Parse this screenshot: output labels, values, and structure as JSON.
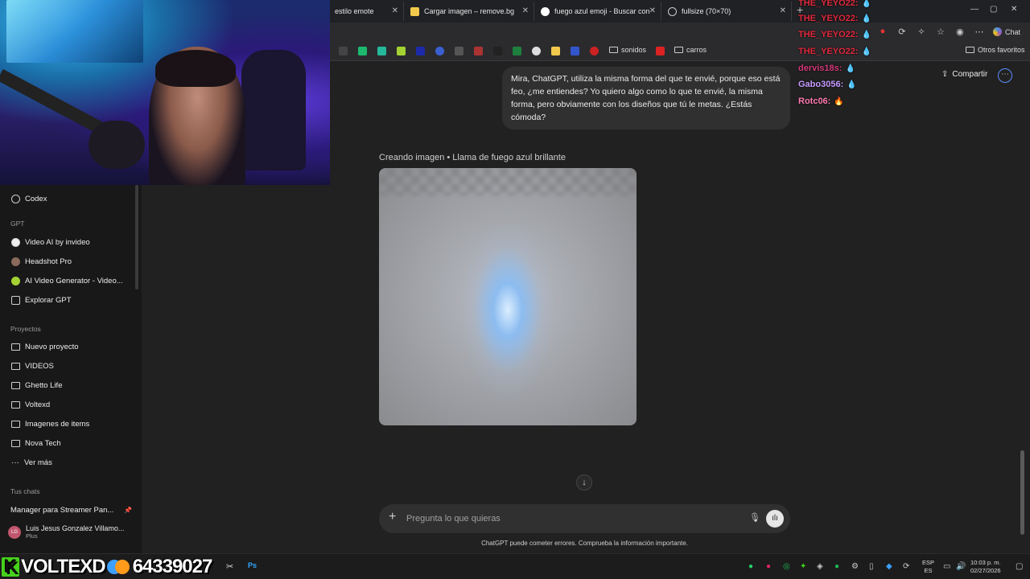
{
  "browser": {
    "tabs": [
      {
        "label": "estilo emote",
        "color": "#888888"
      },
      {
        "label": "Cargar imagen – remove.bg",
        "color": "#f2c94c"
      },
      {
        "label": "fuego azul emoji - Buscar con Goo",
        "color": "#ffffff"
      },
      {
        "label": "fullsize (70×70)",
        "color": "#cccccc"
      }
    ],
    "chat_button": "Chat",
    "bookmark_folders": [
      "sonidos",
      "carros"
    ],
    "other_favorites": "Otros favoritos"
  },
  "stream_chat": [
    {
      "user": "THE_YEYO22:",
      "color": "#e0283c",
      "icon": "drop"
    },
    {
      "user": "THE_YEYO22:",
      "color": "#e0283c",
      "icon": "drop"
    },
    {
      "user": "THE_YEYO22:",
      "color": "#e0283c",
      "icon": "drop"
    },
    {
      "user": "THE_YEYO22:",
      "color": "#e0283c",
      "icon": "drop"
    },
    {
      "user": "dervis18s:",
      "color": "#d4387a",
      "icon": "drop"
    },
    {
      "user": "Gabo3056:",
      "color": "#c89bff",
      "icon": "drop"
    },
    {
      "user": "Rotc06:",
      "color": "#ff7ab0",
      "icon": "fire"
    }
  ],
  "sidebar": {
    "top_items": [
      {
        "label": "Codex",
        "icon": "codex-icon"
      }
    ],
    "gpt_heading": "GPT",
    "gpts": [
      {
        "label": "Video AI by invideo",
        "icon": "invideo-icon"
      },
      {
        "label": "Headshot Pro",
        "icon": "headshot-icon"
      },
      {
        "label": "AI Video Generator - Video...",
        "icon": "video-generator-icon"
      },
      {
        "label": "Explorar GPT",
        "icon": "explore-icon"
      }
    ],
    "projects_heading": "Proyectos",
    "projects": [
      {
        "label": "Nuevo proyecto",
        "icon": "new-folder-icon"
      },
      {
        "label": "VIDEOS",
        "icon": "folder-icon"
      },
      {
        "label": "Ghetto Life",
        "icon": "folder-icon"
      },
      {
        "label": "Voltexd",
        "icon": "folder-icon"
      },
      {
        "label": "Imagenes de items",
        "icon": "folder-icon"
      },
      {
        "label": "Nova Tech",
        "icon": "folder-icon"
      },
      {
        "label": "Ver más",
        "icon": "ellipsis-icon"
      }
    ],
    "chats_heading": "Tus chats",
    "chats": [
      {
        "label": "Manager para Streamer Pan..."
      }
    ],
    "user": {
      "initials": "LG",
      "name": "Luis Jesus Gonzalez Villamo...",
      "plan": "Plus"
    }
  },
  "main": {
    "share_label": "Compartir",
    "user_message": "Mira, ChatGPT, utiliza la misma forma del que te envié, porque eso está feo, ¿me entiendes? Yo quiero algo como lo que te envié, la misma forma, pero obviamente con los diseños que tú le metas. ¿Estás cómoda?",
    "generating_label": "Creando imagen • Llama de fuego azul brillante",
    "composer_placeholder": "Pregunta lo que quieras",
    "disclaimer": "ChatGPT puede cometer errores. Comprueba la información importante."
  },
  "taskbar": {
    "streamer_tag": "VOLTEXD",
    "coins_value": "64339027",
    "language": "ESP",
    "language_sub": "ES",
    "time": "10:03 p. m.",
    "date": "02/27/2026"
  }
}
